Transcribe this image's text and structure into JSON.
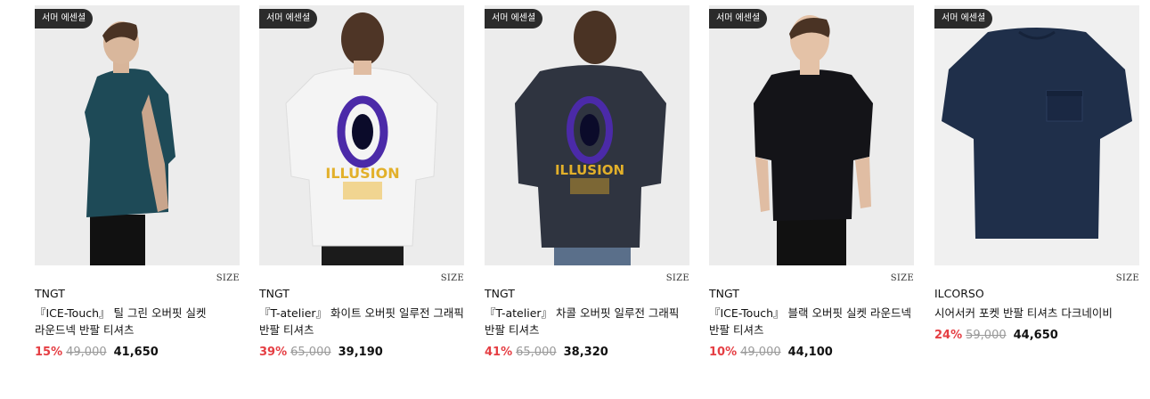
{
  "products": [
    {
      "badge": "서머 에센셜",
      "size_label": "SIZE",
      "brand": "TNGT",
      "name": "『ICE-Touch』 틸 그린 오버핏 실켓 라운드넥 반팔 티셔츠",
      "discount": "15%",
      "original_price": "49,000",
      "sale_price": "41,650",
      "shirt_color": "#1e4a57",
      "graphic": "none"
    },
    {
      "badge": "서머 에센셜",
      "size_label": "SIZE",
      "brand": "TNGT",
      "name": "『T-atelier』 화이트 오버핏 일루전 그래픽 반팔 티셔츠",
      "discount": "39%",
      "original_price": "65,000",
      "sale_price": "39,190",
      "shirt_color": "#f4f4f4",
      "graphic": "illusion"
    },
    {
      "badge": "서머 에센셜",
      "size_label": "SIZE",
      "brand": "TNGT",
      "name": "『T-atelier』 차콜 오버핏 일루전 그래픽 반팔 티셔츠",
      "discount": "41%",
      "original_price": "65,000",
      "sale_price": "38,320",
      "shirt_color": "#2f3440",
      "graphic": "illusion"
    },
    {
      "badge": "서머 에센셜",
      "size_label": "SIZE",
      "brand": "TNGT",
      "name": "『ICE-Touch』 블랙 오버핏 실켓 라운드넥 반팔 티셔츠",
      "discount": "10%",
      "original_price": "49,000",
      "sale_price": "44,100",
      "shirt_color": "#141418",
      "graphic": "none"
    },
    {
      "badge": "서머 에센셜",
      "size_label": "SIZE",
      "brand": "ILCORSO",
      "name": "시어서커 포켓 반팔 티셔츠 다크네이비",
      "discount": "24%",
      "original_price": "59,000",
      "sale_price": "44,650",
      "shirt_color": "#1f2f4a",
      "graphic": "flatlay"
    }
  ],
  "colors": {
    "discount": "#e53e43",
    "original_price": "#9a9a9a",
    "badge_bg": "#2b2b2b"
  }
}
